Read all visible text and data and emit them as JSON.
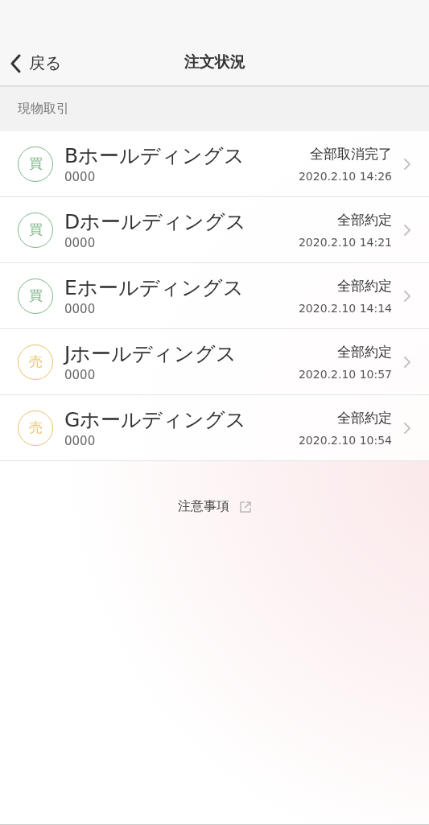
{
  "nav": {
    "back_label": "戻る",
    "title": "注文状況"
  },
  "section": {
    "title": "現物取引"
  },
  "orders": [
    {
      "side": "買",
      "color": "#7fb58a",
      "name": "Bホールディングス",
      "code": "0000",
      "status": "全部取消完了",
      "time": "2020.2.10 14:26"
    },
    {
      "side": "買",
      "color": "#7fb58a",
      "name": "Dホールディングス",
      "code": "0000",
      "status": "全部約定",
      "time": "2020.2.10 14:21"
    },
    {
      "side": "買",
      "color": "#7fb58a",
      "name": "Eホールディングス",
      "code": "0000",
      "status": "全部約定",
      "time": "2020.2.10 14:14"
    },
    {
      "side": "売",
      "color": "#e8c36a",
      "name": "Jホールディングス",
      "code": "0000",
      "status": "全部約定",
      "time": "2020.2.10 10:57"
    },
    {
      "side": "売",
      "color": "#e8c36a",
      "name": "Gホールディングス",
      "code": "0000",
      "status": "全部約定",
      "time": "2020.2.10 10:54"
    }
  ],
  "notes_link": "注意事項"
}
